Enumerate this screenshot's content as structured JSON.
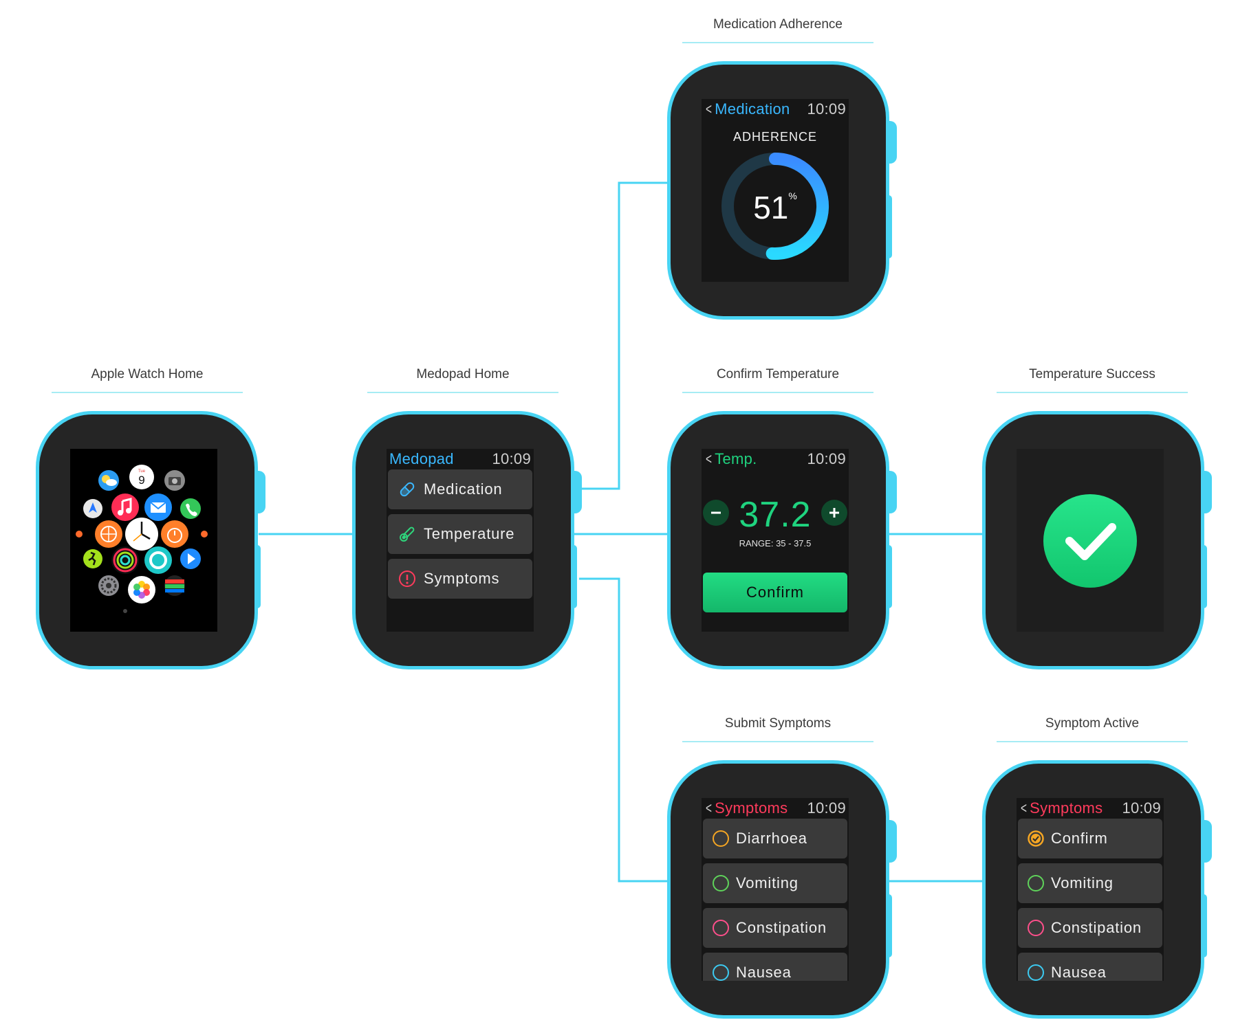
{
  "labels": {
    "apple_watch_home": "Apple Watch Home",
    "medopad_home": "Medopad Home",
    "medication_adherence": "Medication Adherence",
    "confirm_temperature": "Confirm Temperature",
    "temperature_success": "Temperature Success",
    "submit_symptoms": "Submit Symptoms",
    "symptom_active": "Symptom Active"
  },
  "colors": {
    "accent_cyan": "#48d4f3",
    "case": "#252525",
    "screen": "#161616",
    "green": "#1fd37f",
    "symptoms_red": "#ff3b5c",
    "medication_blue": "#3ab8ff"
  },
  "apple_home": {
    "calendar_day_label": "Tue",
    "calendar_day_number": "9",
    "app_icons": [
      "weather-icon",
      "calendar-icon",
      "camera-icon",
      "maps-icon",
      "music-icon",
      "mail-icon",
      "phone-icon",
      "world-clock-icon",
      "clock-icon",
      "timer-icon",
      "workout-icon",
      "activity-icon",
      "digital-touch-icon",
      "remote-icon",
      "settings-icon",
      "photos-icon",
      "stocks-icon"
    ]
  },
  "medopad_home": {
    "title": "Medopad",
    "time": "10:09",
    "items": [
      {
        "label": "Medication",
        "icon": "pill-icon"
      },
      {
        "label": "Temperature",
        "icon": "thermometer-icon"
      },
      {
        "label": "Symptoms",
        "icon": "alert-icon"
      }
    ]
  },
  "medication": {
    "title": "Medication",
    "time": "10:09",
    "heading": "ADHERENCE",
    "percent": "51",
    "percent_sign": "%",
    "adherence_fraction": 0.51
  },
  "temperature": {
    "title": "Temp.",
    "time": "10:09",
    "value": "37.2",
    "range_text": "RANGE: 35 - 37.5",
    "confirm_label": "Confirm",
    "minus_icon": "minus-icon",
    "plus_icon": "plus-icon"
  },
  "success": {
    "icon": "checkmark-icon"
  },
  "submit_symptoms": {
    "title": "Symptoms",
    "time": "10:09",
    "items": [
      {
        "label": "Diarrhoea",
        "color": "#f5a623",
        "checked": false
      },
      {
        "label": "Vomiting",
        "color": "#5fd35a",
        "checked": false
      },
      {
        "label": "Constipation",
        "color": "#ff4f8b",
        "checked": false
      },
      {
        "label": "Nausea",
        "color": "#3ccbf2",
        "checked": false
      }
    ]
  },
  "symptom_active": {
    "title": "Symptoms",
    "time": "10:09",
    "items": [
      {
        "label": "Confirm",
        "color": "#f5a623",
        "checked": true
      },
      {
        "label": "Vomiting",
        "color": "#5fd35a",
        "checked": false
      },
      {
        "label": "Constipation",
        "color": "#ff4f8b",
        "checked": false
      },
      {
        "label": "Nausea",
        "color": "#3ccbf2",
        "checked": false
      }
    ]
  }
}
